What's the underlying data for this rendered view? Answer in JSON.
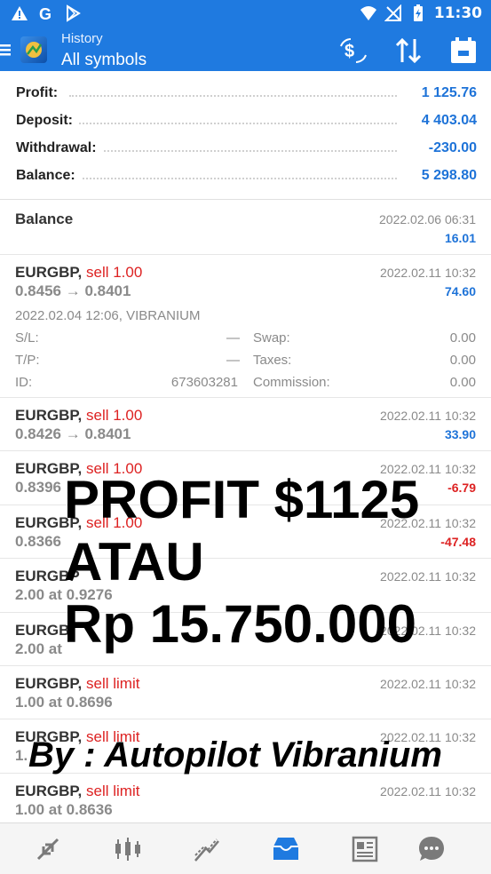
{
  "status_bar": {
    "time": "11:30",
    "icons": [
      "warning-icon",
      "google-icon",
      "play-store-icon",
      "wifi-icon",
      "no-signal-icon",
      "battery-charging-icon"
    ]
  },
  "app_bar": {
    "title_small": "History",
    "title_big": "All symbols",
    "actions": [
      "currency-exchange-icon",
      "sort-icon",
      "calendar-icon"
    ]
  },
  "summary": {
    "profit_label": "Profit:",
    "profit_value": "1 125.76",
    "deposit_label": "Deposit:",
    "deposit_value": "4 403.04",
    "withdrawal_label": "Withdrawal:",
    "withdrawal_value": "-230.00",
    "balance_label": "Balance:",
    "balance_value": "5 298.80"
  },
  "balance_row": {
    "title": "Balance",
    "date": "2022.02.06 06:31",
    "amount": "16.01"
  },
  "expanded_row": {
    "symbol": "EURGBP,",
    "side": "sell 1.00",
    "prices": "0.8456 → 0.8401",
    "date": "2022.02.11 10:32",
    "amount": "74.60",
    "open_info": "2022.02.04 12:06, VIBRANIUM",
    "sl_label": "S/L:",
    "sl_value": "—",
    "tp_label": "T/P:",
    "tp_value": "—",
    "id_label": "ID:",
    "id_value": "673603281",
    "swap_label": "Swap:",
    "swap_value": "0.00",
    "taxes_label": "Taxes:",
    "taxes_value": "0.00",
    "commission_label": "Commission:",
    "commission_value": "0.00"
  },
  "rows": [
    {
      "symbol": "EURGBP,",
      "side": "sell 1.00",
      "sub": "0.8426 → 0.8401",
      "date": "2022.02.11 10:32",
      "amount": "33.90",
      "sign": "pos"
    },
    {
      "symbol": "EURGBP,",
      "side": "sell 1.00",
      "sub": "0.8396",
      "date": "2022.02.11 10:32",
      "amount": "-6.79",
      "sign": "neg"
    },
    {
      "symbol": "EURGBP,",
      "side": "sell 1.00",
      "sub": "0.8366",
      "date": "2022.02.11 10:32",
      "amount": "-47.48",
      "sign": "neg"
    },
    {
      "symbol": "EURGBP",
      "side": "",
      "sub": "2.00 at 0.9276",
      "date": "2022.02.11 10:32",
      "amount": "",
      "sign": "pos"
    },
    {
      "symbol": "EURGB",
      "side": "",
      "sub": "2.00 at",
      "date": "2022.02.11 10:32",
      "amount": "",
      "sign": "pos"
    },
    {
      "symbol": "EURGBP,",
      "side": "sell limit",
      "sub": "1.00 at 0.8696",
      "date": "2022.02.11 10:32",
      "amount": "",
      "sign": "pos"
    },
    {
      "symbol": "EURGBP,",
      "side": "sell limit",
      "sub": "1.",
      "date": "2022.02.11 10:32",
      "amount": "",
      "sign": "pos"
    },
    {
      "symbol": "EURGBP,",
      "side": "sell limit",
      "sub": "1.00 at 0.8636",
      "date": "2022.02.11 10:32",
      "amount": "",
      "sign": "pos"
    }
  ],
  "overlay": {
    "line1": "PROFIT $1125",
    "line2": "ATAU",
    "line3": "Rp 15.750.000",
    "byline": "By : Autopilot Vibranium"
  },
  "bottom_nav": [
    "quotes-icon",
    "chart-icon",
    "trade-icon",
    "history-icon",
    "news-icon",
    "chat-icon"
  ],
  "colors": {
    "primary": "#1f7ae0",
    "positive": "#1e73d8",
    "negative": "#dd2222",
    "muted": "#8a8a8a"
  }
}
